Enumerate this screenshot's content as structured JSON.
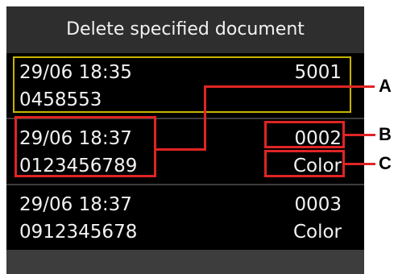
{
  "dialog": {
    "title": "Delete specified document"
  },
  "documents": [
    {
      "date_time": "29/06  18:35",
      "number": "0458553",
      "transaction_id": "5001",
      "color_mode": "",
      "selected": true
    },
    {
      "date_time": "29/06  18:37",
      "number": "0123456789",
      "transaction_id": "0002",
      "color_mode": "Color",
      "selected": false
    },
    {
      "date_time": "29/06  18:37",
      "number": "0912345678",
      "transaction_id": "0003",
      "color_mode": "Color",
      "selected": false
    }
  ],
  "annotations": [
    {
      "label": "A"
    },
    {
      "label": "B"
    },
    {
      "label": "C"
    }
  ],
  "colors": {
    "selection_border": "#c9b400",
    "callout": "#e02424",
    "screen_bg": "#3d3d3d",
    "row_bg": "#000000",
    "text": "#f2f2f2"
  }
}
